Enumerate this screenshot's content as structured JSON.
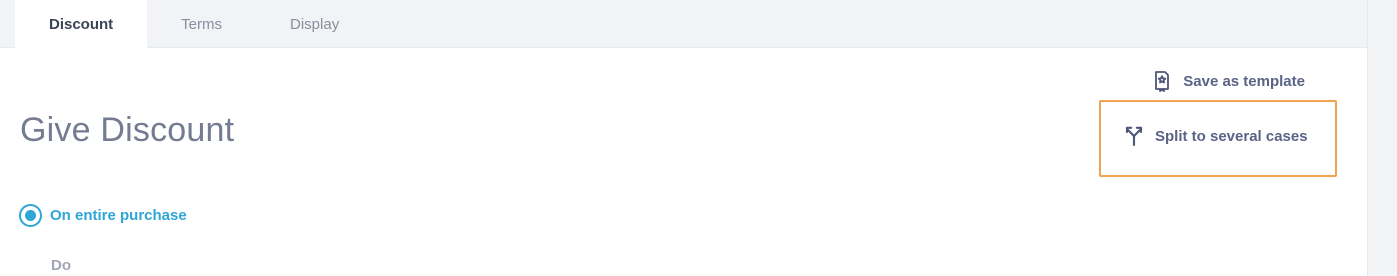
{
  "tabs": [
    {
      "label": "Discount",
      "active": true
    },
    {
      "label": "Terms",
      "active": false
    },
    {
      "label": "Display",
      "active": false
    }
  ],
  "main": {
    "title": "Give Discount",
    "save_template_label": "Save as template",
    "split_cases_label": "Split to several cases",
    "radio_option_label": "On entire purchase",
    "do_label": "Do"
  },
  "icons": {
    "save_template": "bookmark-star-icon",
    "split_cases": "split-branch-icon"
  },
  "colors": {
    "accent_blue": "#2ea6d8",
    "link_slate": "#5b6386",
    "highlight_orange": "#f0a351"
  }
}
